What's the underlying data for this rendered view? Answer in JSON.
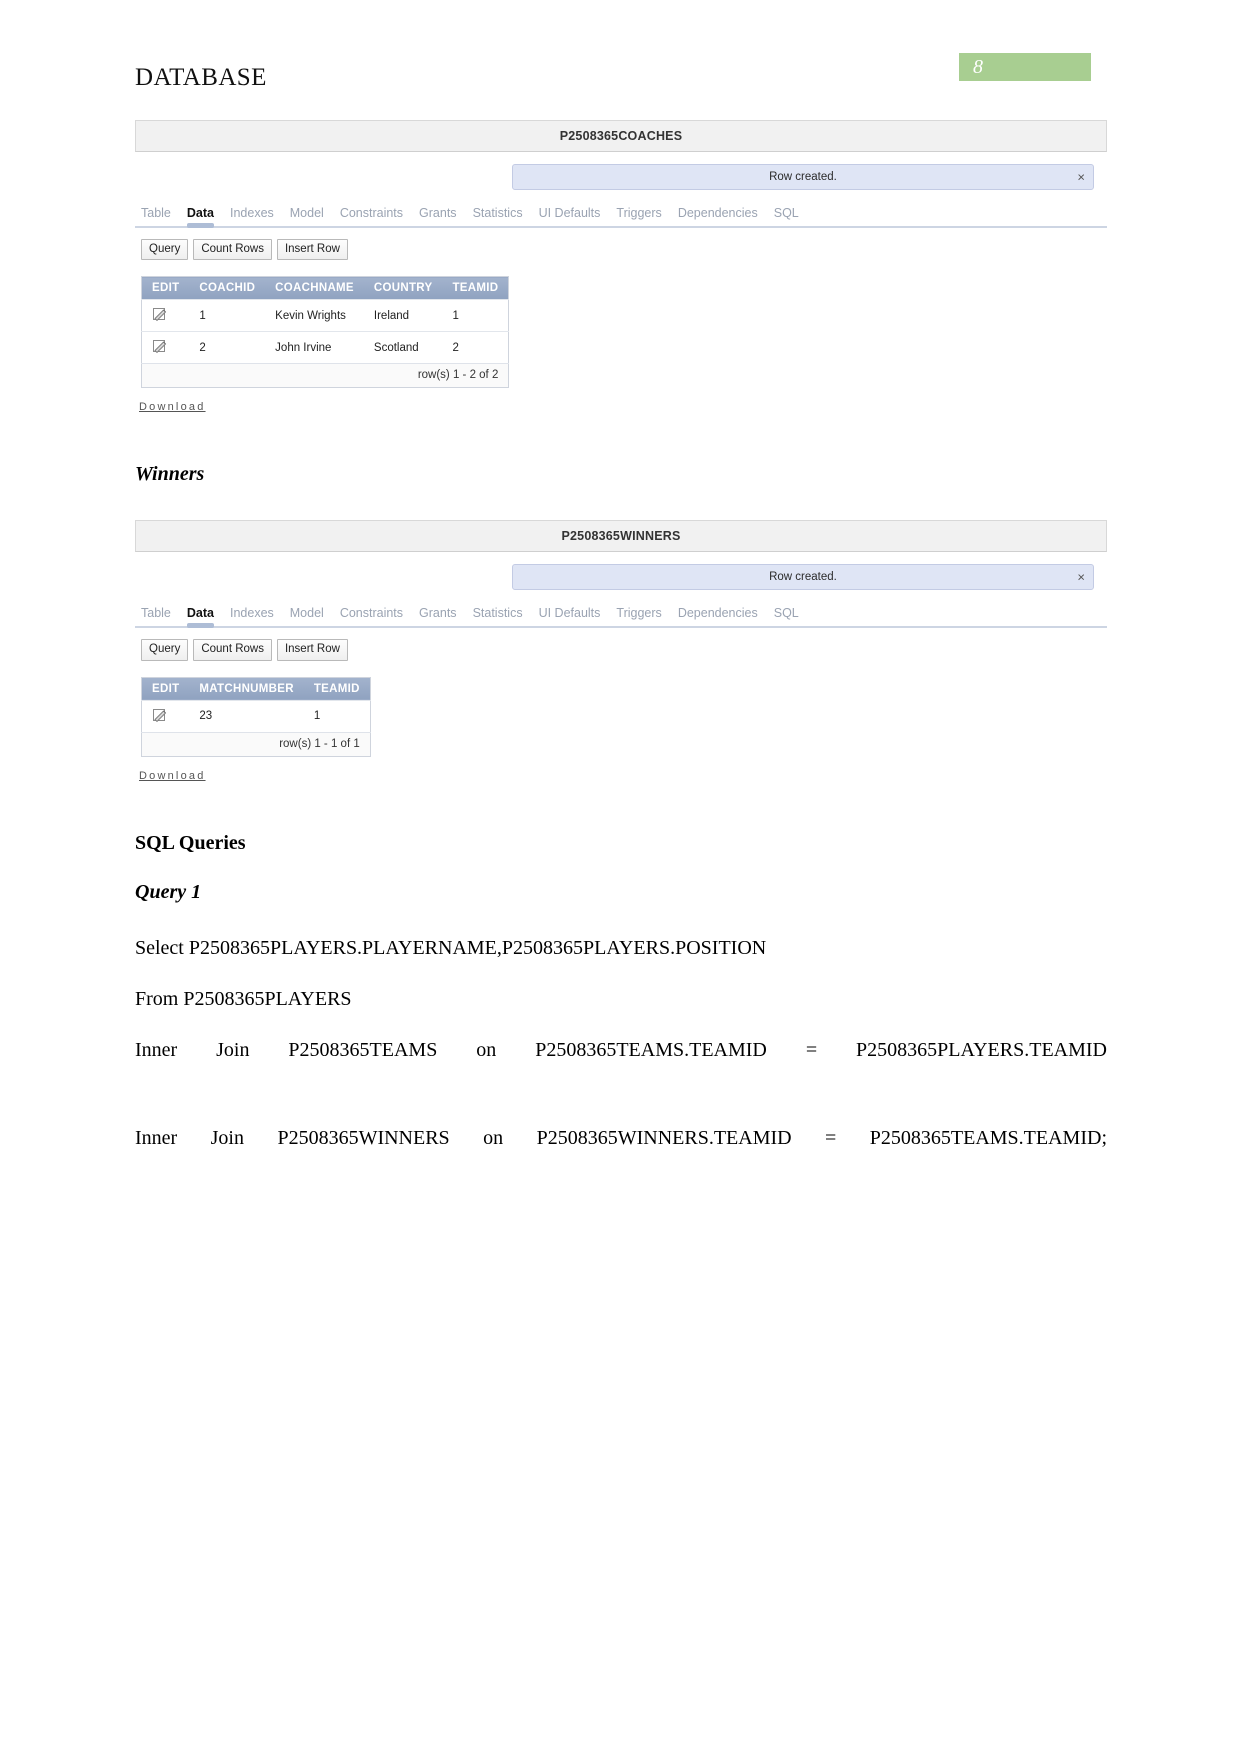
{
  "header": {
    "doc_title": "DATABASE",
    "page_number": "8"
  },
  "colors": {
    "page_badge_bg": "#a8ce91",
    "grid_header_bg": "#96a7c6",
    "alert_bg": "#dfe5f5",
    "tab_active_underline": "#aebdd6"
  },
  "coaches_panel": {
    "title": "P2508365COACHES",
    "alert": {
      "message": "Row created.",
      "close_label": "×"
    },
    "tabs": [
      {
        "label": "Table",
        "active": false
      },
      {
        "label": "Data",
        "active": true
      },
      {
        "label": "Indexes",
        "active": false
      },
      {
        "label": "Model",
        "active": false
      },
      {
        "label": "Constraints",
        "active": false
      },
      {
        "label": "Grants",
        "active": false
      },
      {
        "label": "Statistics",
        "active": false
      },
      {
        "label": "UI Defaults",
        "active": false
      },
      {
        "label": "Triggers",
        "active": false
      },
      {
        "label": "Dependencies",
        "active": false
      },
      {
        "label": "SQL",
        "active": false
      }
    ],
    "buttons": [
      {
        "label": "Query"
      },
      {
        "label": "Count Rows"
      },
      {
        "label": "Insert Row"
      }
    ],
    "grid": {
      "columns": [
        "EDIT",
        "COACHID",
        "COACHNAME",
        "COUNTRY",
        "TEAMID"
      ],
      "rows": [
        {
          "coachid": "1",
          "coachname": "Kevin Wrights",
          "country": "Ireland",
          "teamid": "1"
        },
        {
          "coachid": "2",
          "coachname": "John Irvine",
          "country": "Scotland",
          "teamid": "2"
        }
      ],
      "footer": "row(s) 1 - 2 of 2"
    },
    "download_label": "Download"
  },
  "winners_heading": "Winners",
  "winners_panel": {
    "title": "P2508365WINNERS",
    "alert": {
      "message": "Row created.",
      "close_label": "×"
    },
    "tabs": [
      {
        "label": "Table",
        "active": false
      },
      {
        "label": "Data",
        "active": true
      },
      {
        "label": "Indexes",
        "active": false
      },
      {
        "label": "Model",
        "active": false
      },
      {
        "label": "Constraints",
        "active": false
      },
      {
        "label": "Grants",
        "active": false
      },
      {
        "label": "Statistics",
        "active": false
      },
      {
        "label": "UI Defaults",
        "active": false
      },
      {
        "label": "Triggers",
        "active": false
      },
      {
        "label": "Dependencies",
        "active": false
      },
      {
        "label": "SQL",
        "active": false
      }
    ],
    "buttons": [
      {
        "label": "Query"
      },
      {
        "label": "Count Rows"
      },
      {
        "label": "Insert Row"
      }
    ],
    "grid": {
      "columns": [
        "EDIT",
        "MATCHNUMBER",
        "TEAMID"
      ],
      "rows": [
        {
          "matchnumber": "23",
          "teamid": "1"
        }
      ],
      "footer": "row(s) 1 - 1 of 1"
    },
    "download_label": "Download"
  },
  "sql_section": {
    "heading": "SQL Queries",
    "query_heading": "Query 1",
    "lines": [
      "Select P2508365PLAYERS.PLAYERNAME,P2508365PLAYERS.POSITION",
      "From P2508365PLAYERS",
      "Inner Join P2508365TEAMS on P2508365TEAMS.TEAMID = P2508365PLAYERS.TEAMID",
      "Inner Join P2508365WINNERS on P2508365WINNERS.TEAMID = P2508365TEAMS.TEAMID;"
    ]
  }
}
